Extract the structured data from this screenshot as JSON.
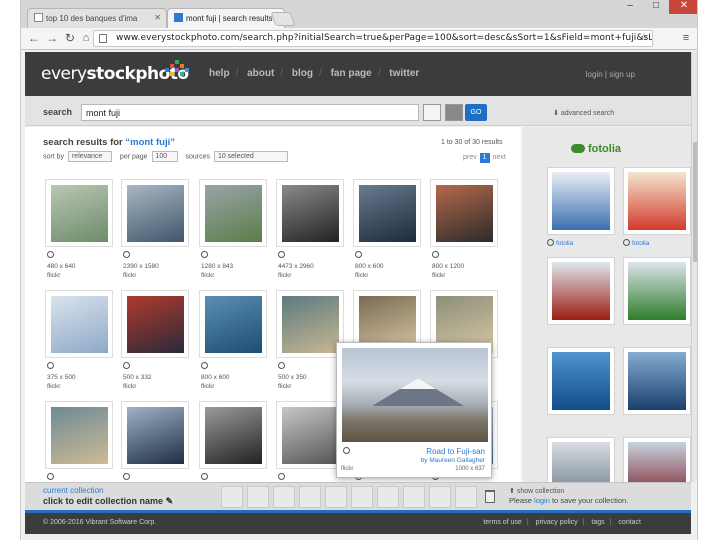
{
  "browser": {
    "tabs": [
      {
        "title": "top 10 des banques d'ima",
        "active": false
      },
      {
        "title": "mont fuji | search results ",
        "active": true
      }
    ],
    "url": "www.everystockphoto.com/search.php?initialSearch=true&perPage=100&sort=desc&sSort=1&sField=mont+fuji&sLayout",
    "window_controls": [
      "–",
      "□",
      "✕"
    ]
  },
  "site": {
    "logo_light": "every",
    "logo_bold": "stockphoto",
    "nav": [
      "help",
      "about",
      "blog",
      "fan page",
      "twitter"
    ],
    "login": "login",
    "signup": "sign up"
  },
  "search": {
    "label": "search",
    "value": "mont fuji",
    "go": "GO",
    "advanced": "advanced search"
  },
  "results": {
    "title_prefix": "search results for ",
    "query": "“mont fuji”",
    "sort_label": "sort by",
    "sort_value": "relevance",
    "per_page_label": "per page",
    "per_page_value": "100",
    "sources_label": "sources",
    "sources_value": "10 selected",
    "count": "1 to 30 of 30 results",
    "prev": "prev",
    "page": "1",
    "next": "next",
    "rows": [
      [
        {
          "size": "480 x 640",
          "source": "flickr",
          "colors": [
            "#6d8b6a",
            "#b9c7b2"
          ]
        },
        {
          "size": "2390 x 1580",
          "source": "flickr",
          "colors": [
            "#3f566c",
            "#a9b7c2"
          ]
        },
        {
          "size": "1280 x 843",
          "source": "flickr",
          "colors": [
            "#5a7d4a",
            "#9aa4a7"
          ]
        },
        {
          "size": "4473 x 2960",
          "source": "flickr",
          "colors": [
            "#222222",
            "#8a8a8a"
          ]
        },
        {
          "size": "800 x 600",
          "source": "flickr",
          "colors": [
            "#1b2a3c",
            "#6a7b8f"
          ]
        },
        {
          "size": "800 x 1200",
          "source": "flickr",
          "colors": [
            "#2b2b2b",
            "#b5694a"
          ]
        }
      ],
      [
        {
          "size": "375 x 500",
          "source": "flickr",
          "colors": [
            "#8fa8c8",
            "#d8e2ec"
          ]
        },
        {
          "size": "500 x 332",
          "source": "flickr",
          "colors": [
            "#2a2a3a",
            "#b03a2e"
          ]
        },
        {
          "size": "800 x 600",
          "source": "flickr",
          "colors": [
            "#1c4e73",
            "#5b8fb0"
          ]
        },
        {
          "size": "500 x 350",
          "source": "flickr",
          "colors": [
            "#c7b790",
            "#5c7a82"
          ]
        },
        {
          "size": "",
          "source": "",
          "colors": [
            "#d9c9a5",
            "#7a6a52"
          ]
        },
        {
          "size": "",
          "source": "",
          "colors": [
            "#d7c8a2",
            "#8d8f7a"
          ]
        }
      ],
      [
        {
          "size": "",
          "source": "",
          "colors": [
            "#cdbb94",
            "#6e8a96"
          ]
        },
        {
          "size": "",
          "source": "",
          "colors": [
            "#1e2e44",
            "#9fb2c8"
          ]
        },
        {
          "size": "",
          "source": "",
          "colors": [
            "#222222",
            "#9a9a9a"
          ]
        },
        {
          "size": "",
          "source": "",
          "colors": [
            "#555555",
            "#c7c7c7"
          ]
        },
        {
          "size": "",
          "source": "",
          "colors": [
            "#3e5566",
            "#b7c6d3"
          ]
        },
        {
          "size": "",
          "source": "",
          "colors": [
            "#4a6a8a",
            "#c9d3dc"
          ]
        }
      ]
    ]
  },
  "preview": {
    "title": "Road to Fuji-san",
    "by": "by Maureen Gallagher",
    "source": "flickr",
    "size": "1000 x 637"
  },
  "fotolia": {
    "brand": "fotolia",
    "items": [
      {
        "label": "fotolia",
        "colors": [
          "#3a6fb0",
          "#e9eef5"
        ]
      },
      {
        "label": "fotolia",
        "colors": [
          "#d33a2c",
          "#f3e6d0"
        ]
      },
      {
        "label": "",
        "colors": [
          "#9b1c12",
          "#dfe7ee"
        ]
      },
      {
        "label": "",
        "colors": [
          "#2f7d2a",
          "#dbe4ec"
        ]
      },
      {
        "label": "",
        "colors": [
          "#0f4d8a",
          "#4f93cf"
        ]
      },
      {
        "label": "",
        "colors": [
          "#1a3f6e",
          "#86abd1"
        ]
      },
      {
        "label": "",
        "colors": [
          "#6a7a8a",
          "#d9dde2"
        ]
      },
      {
        "label": "",
        "colors": [
          "#7a1f2a",
          "#c7d3de"
        ]
      }
    ]
  },
  "collection": {
    "current": "current collection",
    "edit": "click to edit collection name",
    "show": "show collection",
    "save_prefix": "Please ",
    "save_link": "login",
    "save_suffix": " to save your collection."
  },
  "footer": {
    "copyright": "© 2006-2016 Vibrant Software Corp.",
    "links": [
      "terms of use",
      "privacy policy",
      "tags",
      "contact"
    ]
  }
}
